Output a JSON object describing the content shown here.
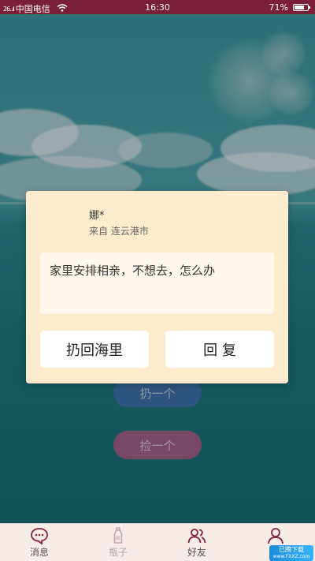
{
  "status_bar": {
    "signal": "26..ıl",
    "carrier": "中国电信",
    "time": "16:30",
    "battery": "71%",
    "battery_level": 0.71
  },
  "background_buttons": {
    "throw": "扔一个",
    "pick": "捡一个"
  },
  "dialog": {
    "sender_name": "娜*",
    "sender_origin": "来自 连云港市",
    "message": "家里安排相亲，不想去，怎么办",
    "return_button": "扔回海里",
    "reply_button": "回 复"
  },
  "tab_bar": {
    "items": [
      {
        "label": "消息",
        "icon": "message-bubble-icon"
      },
      {
        "label": "瓶子",
        "icon": "bottle-icon"
      },
      {
        "label": "好友",
        "icon": "friends-icon"
      },
      {
        "label": "我",
        "icon": "profile-icon"
      }
    ]
  },
  "watermark": {
    "line1": "已腾下载",
    "line2": "www.FXXZ.com"
  }
}
